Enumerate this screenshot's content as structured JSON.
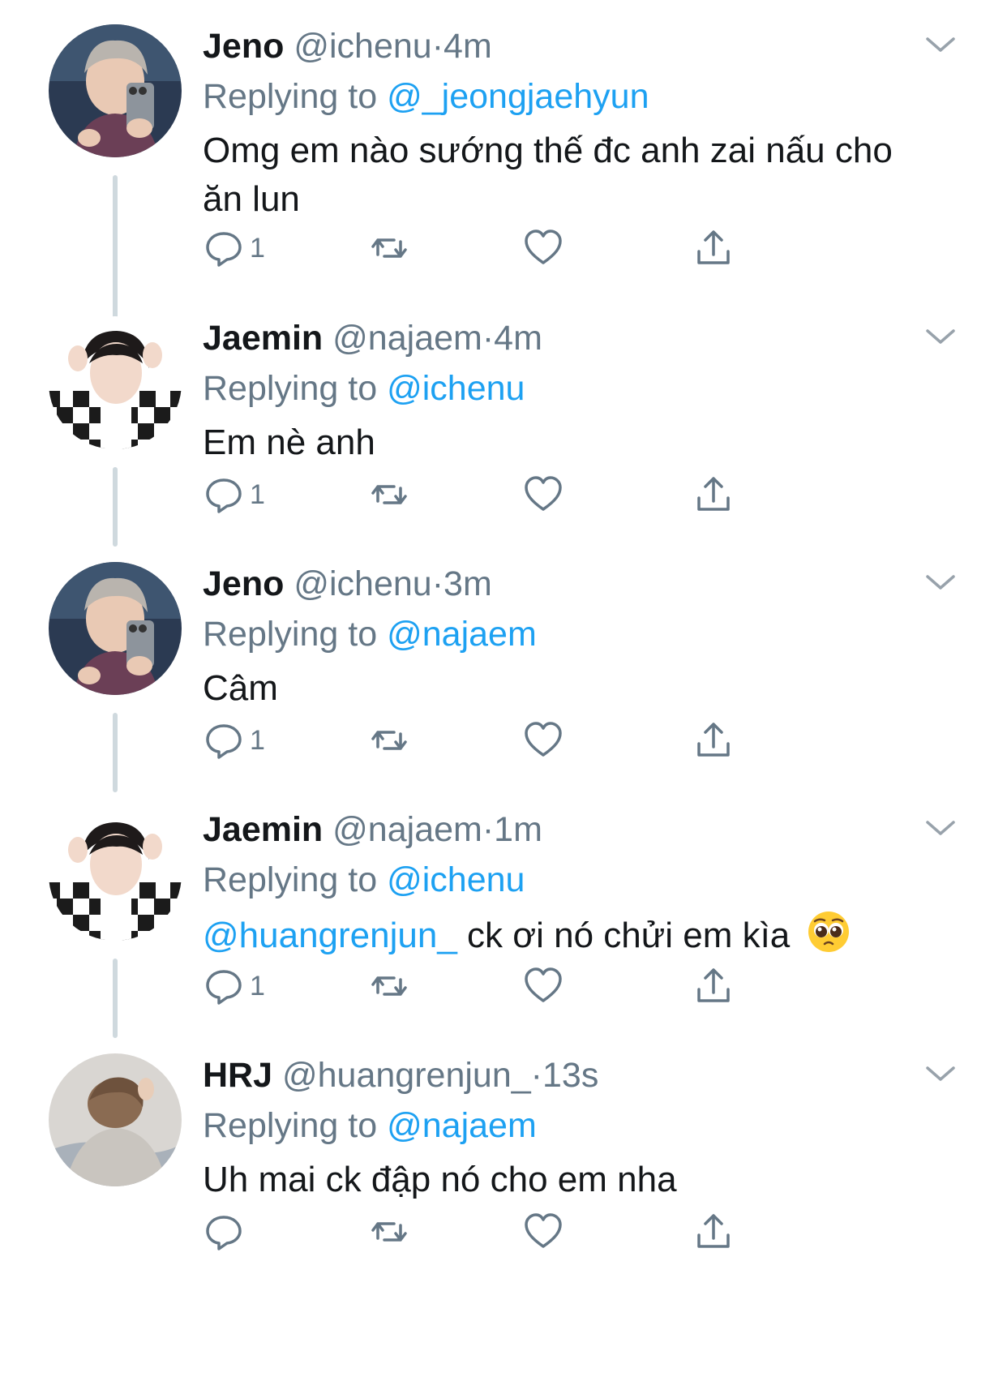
{
  "tweets": [
    {
      "name": "Jeno",
      "handle": "@ichenu",
      "dot": "·",
      "time": "4m",
      "replying_prefix": "Replying to",
      "replying_to": "@_jeongjaehyun",
      "text": "Omg em nào sướng thế đc anh zai nấu cho ăn lun",
      "reply_count": "1",
      "avatar": "avatar-jeno"
    },
    {
      "name": "Jaemin",
      "handle": "@najaem",
      "dot": "·",
      "time": "4m",
      "replying_prefix": "Replying to",
      "replying_to": "@ichenu",
      "text": "Em nè anh",
      "reply_count": "1",
      "avatar": "avatar-jaemin"
    },
    {
      "name": "Jeno",
      "handle": "@ichenu",
      "dot": "·",
      "time": "3m",
      "replying_prefix": "Replying to",
      "replying_to": "@najaem",
      "text": "Câm",
      "reply_count": "1",
      "avatar": "avatar-jeno"
    },
    {
      "name": "Jaemin",
      "handle": "@najaem",
      "dot": "·",
      "time": "1m",
      "replying_prefix": "Replying to",
      "replying_to": "@ichenu",
      "text_mention": "@huangrenjun_",
      "text": "ck ơi nó chửi em kìa",
      "emoji": "pleading-face-emoji",
      "reply_count": "1",
      "avatar": "avatar-jaemin"
    },
    {
      "name": "HRJ",
      "handle": "@huangrenjun_",
      "dot": "·",
      "time": "13s",
      "replying_prefix": "Replying to",
      "replying_to": "@najaem",
      "text": "Uh mai ck đập nó cho em nha",
      "reply_count": "",
      "avatar": "avatar-hrj"
    }
  ],
  "icons": {
    "reply": "reply-icon",
    "retweet": "retweet-icon",
    "like": "heart-icon",
    "share": "share-icon",
    "caret": "chevron-down-icon"
  },
  "colors": {
    "link": "#1da1f2",
    "secondary_text": "#657786",
    "primary_text": "#14171a",
    "thread_line": "#cfd9de"
  }
}
